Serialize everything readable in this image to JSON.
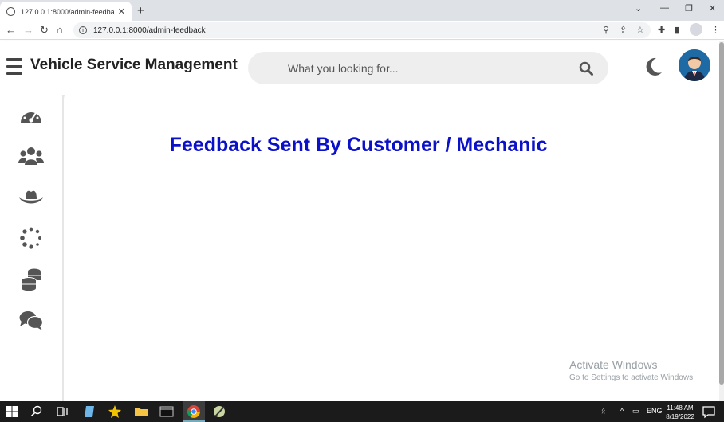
{
  "browser": {
    "tab_title": "127.0.0.1:8000/admin-feedback",
    "url": "127.0.0.1:8000/admin-feedback",
    "new_tab_label": "+",
    "tab_close": "✕"
  },
  "header": {
    "app_title": "Vehicle Service Management",
    "search_placeholder": "What you looking for..."
  },
  "sidebar": {
    "items": [
      {
        "icon": "dashboard-icon"
      },
      {
        "icon": "users-icon"
      },
      {
        "icon": "mechanic-hat-icon"
      },
      {
        "icon": "spinner-icon"
      },
      {
        "icon": "coins-icon"
      },
      {
        "icon": "comments-icon"
      }
    ]
  },
  "main": {
    "title": "Feedback Sent By Customer / Mechanic"
  },
  "watermark": {
    "line1": "Activate Windows",
    "line2": "Go to Settings to activate Windows."
  },
  "taskbar": {
    "language": "ENG",
    "time": "11:48 AM",
    "date": "8/19/2022"
  },
  "colors": {
    "title_blue": "#0b10c9",
    "taskbar_bg": "#1b1b1b"
  }
}
